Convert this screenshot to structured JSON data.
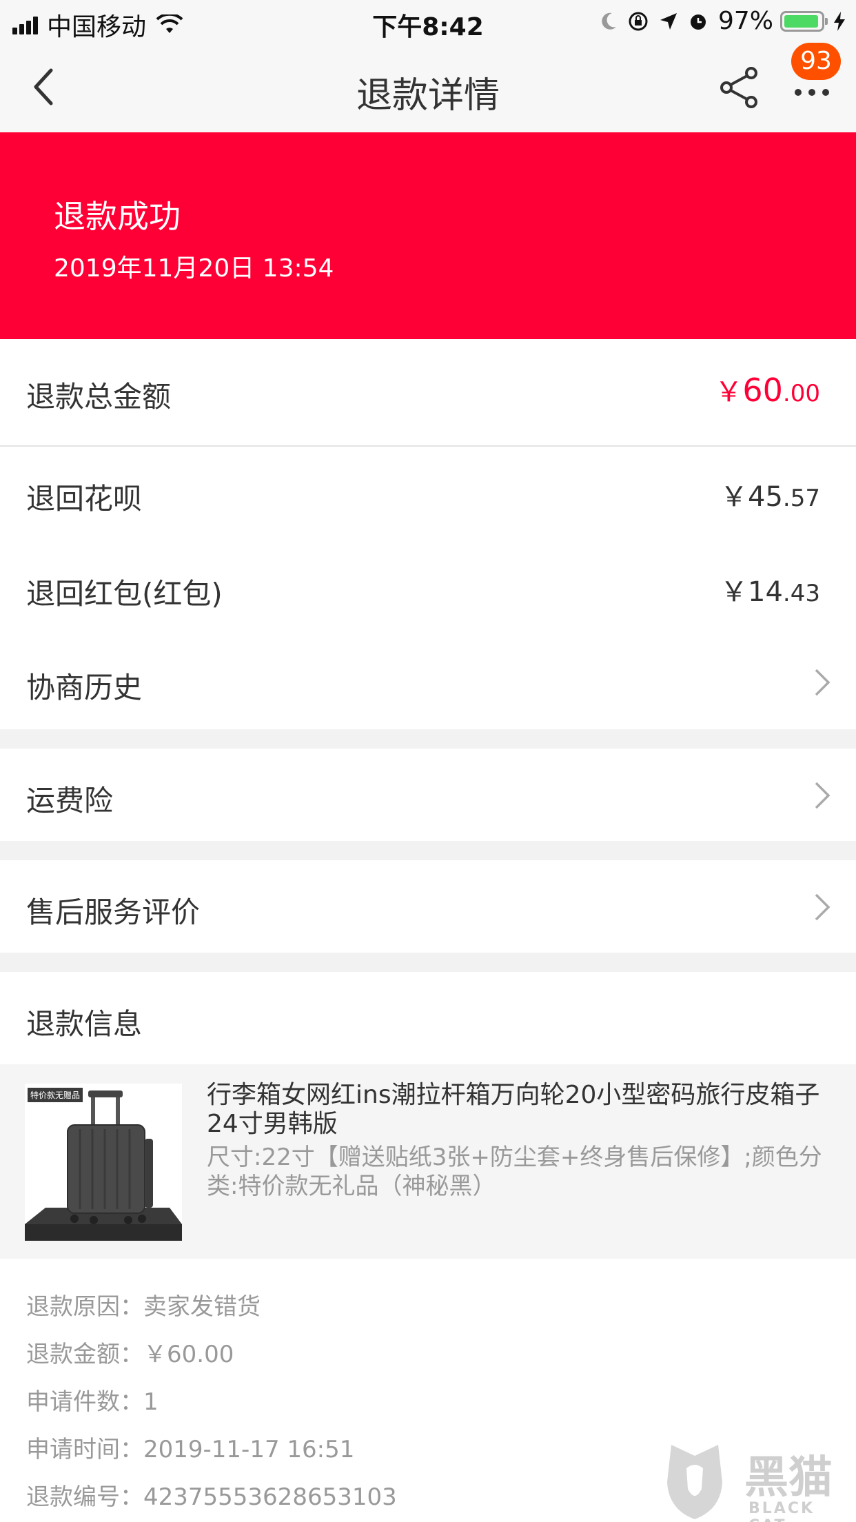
{
  "status_bar": {
    "carrier": "中国移动",
    "time": "下午8:42",
    "battery": "97%",
    "battery_level": 0.97
  },
  "nav": {
    "title": "退款详情",
    "badge": "93"
  },
  "banner": {
    "title": "退款成功",
    "time": "2019年11月20日 13:54",
    "color": "#ff0036"
  },
  "refund_total": {
    "label": "退款总金额",
    "currency": "￥",
    "integer": "60",
    "decimal": ".00"
  },
  "huabei": {
    "label": "退回花呗",
    "currency": "￥",
    "integer": "45",
    "decimal": ".57"
  },
  "hongbao": {
    "label": "退回红包(红包)",
    "currency": "￥",
    "integer": "14",
    "decimal": ".43"
  },
  "menu": {
    "negotiation": "协商历史",
    "shipping_insurance": "运费险",
    "aftersale_review": "售后服务评价"
  },
  "refund_info": {
    "title": "退款信息",
    "product": {
      "thumb_tag": "特价款无赠品",
      "title": "行李箱女网红ins潮拉杆箱万向轮20小型密码旅行皮箱子24寸男韩版",
      "spec": "尺寸:22寸【赠送贴纸3张+防尘套+终身售后保修】;颜色分类:特价款无礼品（神秘黑）"
    },
    "lines": [
      {
        "key": "退款原因：",
        "value": "卖家发错货"
      },
      {
        "key": "退款金额：",
        "value": "￥60.00"
      },
      {
        "key": "申请件数：",
        "value": "1"
      },
      {
        "key": "申请时间：",
        "value": "2019-11-17 16:51"
      },
      {
        "key": "退款编号：",
        "value": "423755536286531​03"
      }
    ]
  },
  "watermark": {
    "text": "黑猫",
    "sub": "BLACK CAT"
  }
}
